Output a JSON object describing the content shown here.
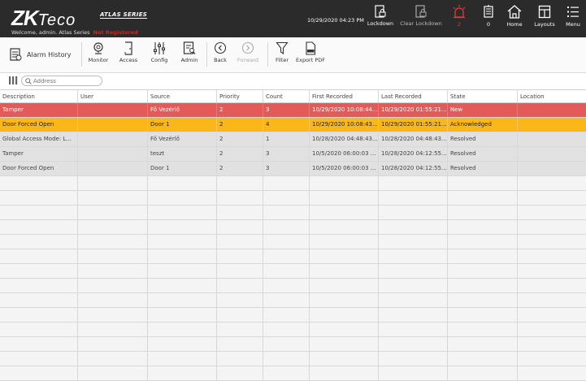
{
  "brand": {
    "logo_main": "ZK",
    "logo_sub": "Teco",
    "series": "ATLAS SERIES",
    "welcome": "Welcome, admin.  Atlas Series",
    "registration": "Not Registered"
  },
  "header": {
    "datetime": "10/29/2020 04:23 PM",
    "actions": [
      {
        "label": "Lockdown",
        "icon": "lockdown-icon"
      },
      {
        "label": "Clear Lockdown",
        "icon": "clear-lockdown-icon"
      },
      {
        "label": "2",
        "icon": "alarm-siren-icon"
      },
      {
        "label": "0",
        "icon": "event-notification-icon"
      },
      {
        "label": "Home",
        "icon": "home-icon"
      },
      {
        "label": "Layouts",
        "icon": "layouts-icon"
      },
      {
        "label": "Menu",
        "icon": "menu-icon"
      }
    ]
  },
  "toolbar": {
    "page_title": "Alarm History",
    "items": [
      "Monitor",
      "Access",
      "Config",
      "Admin",
      "Back",
      "Forward",
      "Filter",
      "Export PDF"
    ]
  },
  "search": {
    "placeholder": "Address"
  },
  "table": {
    "columns": [
      "Description",
      "User",
      "Source",
      "Priority",
      "Count",
      "First Recorded",
      "Last Recorded",
      "State",
      "Location"
    ],
    "rows": [
      {
        "style": "red",
        "cells": [
          "Tamper",
          "",
          "Fő Vezérlő",
          "2",
          "3",
          "10/29/2020 10:08:44...",
          "10/29/2020 01:55:21...",
          "New",
          ""
        ]
      },
      {
        "style": "orange",
        "cells": [
          "Door Forced Open",
          "",
          "Door 1",
          "2",
          "4",
          "10/29/2020 10:08:43...",
          "10/29/2020 01:55:21...",
          "Acknowledged",
          ""
        ]
      },
      {
        "style": "gray",
        "cells": [
          "Global Access Mode: L...",
          "",
          "Fő Vezérlő",
          "2",
          "1",
          "10/28/2020 04:48:43...",
          "10/28/2020 04:48:43...",
          "Resolved",
          ""
        ]
      },
      {
        "style": "gray",
        "cells": [
          "Tamper",
          "",
          "teszt",
          "2",
          "3",
          "10/5/2020 06:00:03 ...",
          "10/28/2020 04:12:55...",
          "Resolved",
          ""
        ]
      },
      {
        "style": "gray",
        "cells": [
          "Door Forced Open",
          "",
          "Door 1",
          "2",
          "3",
          "10/5/2020 06:00:03 ...",
          "10/28/2020 04:12:55...",
          "Resolved",
          ""
        ]
      }
    ]
  },
  "colors": {
    "topbar": "#2b2b2b",
    "new": "#e35a58",
    "acknowledged": "#fbb71a",
    "resolved": "#e1e1e1",
    "alert": "#e53935"
  }
}
